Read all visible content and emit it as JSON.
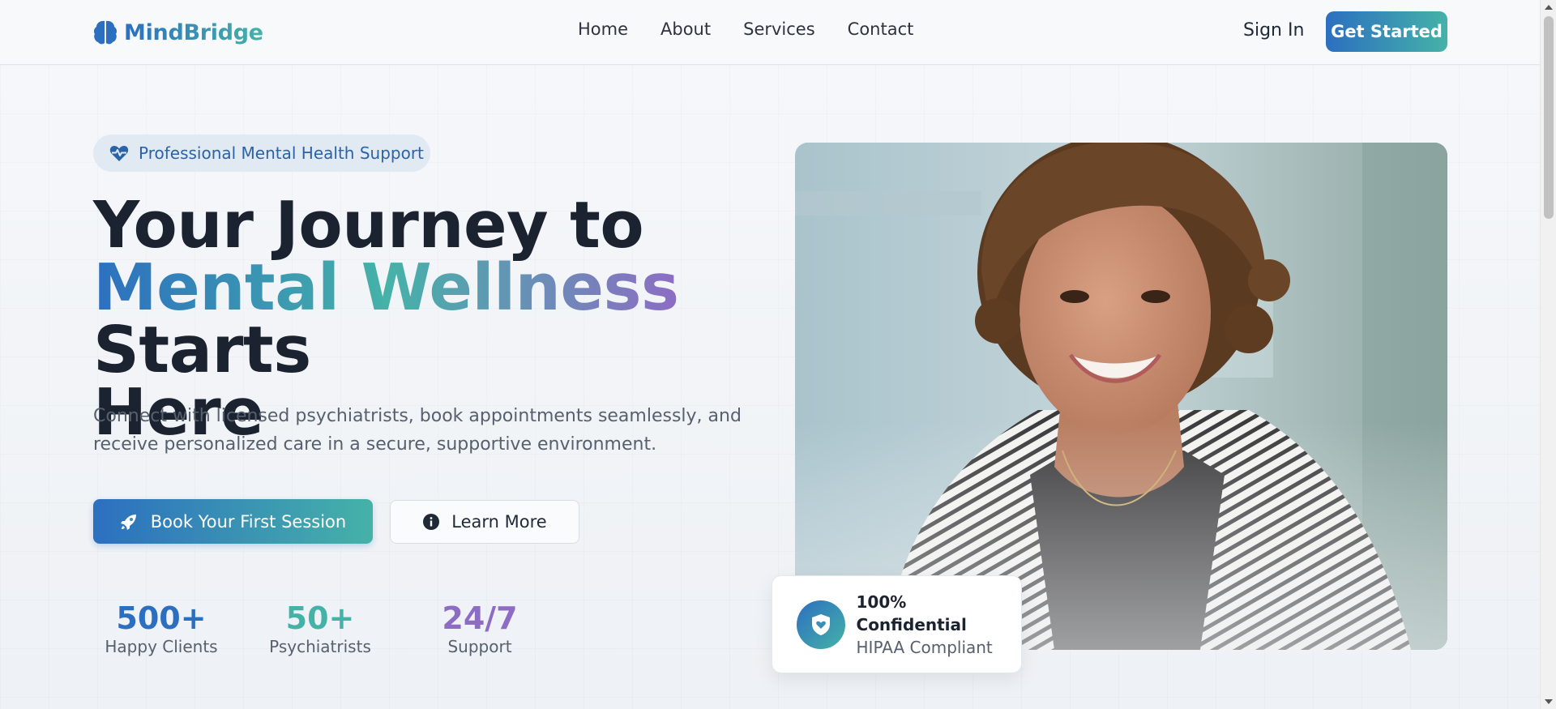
{
  "brand": {
    "name": "MindBridge",
    "icon": "brain-icon"
  },
  "nav": {
    "links": [
      {
        "label": "Home"
      },
      {
        "label": "About"
      },
      {
        "label": "Services"
      },
      {
        "label": "Contact"
      }
    ],
    "sign_in": "Sign In",
    "cta": "Get Started"
  },
  "hero": {
    "badge": {
      "icon": "heart-pulse-icon",
      "text": "Professional Mental Health Support"
    },
    "title_line1": "Your Journey to",
    "title_highlight": "Mental Wellness",
    "title_line2_rest": " Starts",
    "title_line3": "Here",
    "subtitle": "Connect with licensed psychiatrists, book appointments seamlessly, and receive personalized care in a secure, supportive environment.",
    "primary_button": {
      "icon": "rocket-icon",
      "label": "Book Your First Session"
    },
    "secondary_button": {
      "icon": "info-circle-icon",
      "label": "Learn More"
    }
  },
  "stats": [
    {
      "value": "500+",
      "label": "Happy Clients",
      "color": "#2c6fc0"
    },
    {
      "value": "50+",
      "label": "Psychiatrists",
      "color": "#45b2a8"
    },
    {
      "value": "24/7",
      "label": "Support",
      "color": "#8d6cc4"
    }
  ],
  "trust_card": {
    "icon": "shield-heart-icon",
    "title": "100% Confidential",
    "subtitle": "HIPAA Compliant"
  },
  "colors": {
    "primary": "#2c6fc0",
    "teal": "#45b2a8",
    "purple": "#8d6cc4",
    "heading": "#1c2330",
    "muted": "#56606e"
  }
}
